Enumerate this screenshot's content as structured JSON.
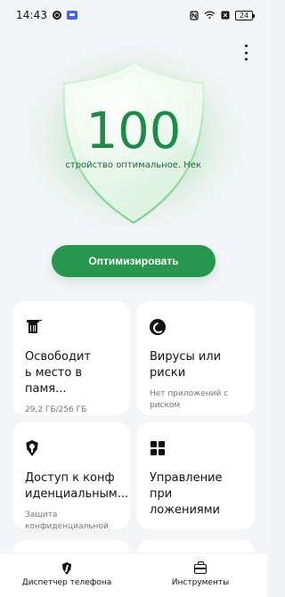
{
  "status_bar": {
    "time": "14:43",
    "battery": "24",
    "icons": [
      "gear-icon",
      "app-icon",
      "nfc-icon",
      "wifi-icon",
      "close-box-icon",
      "battery-icon"
    ]
  },
  "hero": {
    "score": "100",
    "status_text": "Ваше устройство оптимальное. Некоторые"
  },
  "actions": {
    "optimize_label": "Оптимизировать"
  },
  "cards": [
    {
      "title": "Освободит\nь место в памя...",
      "subtitle": "29,2 ГБ/256 ГБ",
      "icon": "trash-icon"
    },
    {
      "title": "Вирусы или\nриски",
      "subtitle": "Нет приложений с\nриском",
      "icon": "virus-scan-icon"
    },
    {
      "title": "Доступ к конф\nиденциальным...",
      "subtitle": "Защита\nконфиденциальной",
      "icon": "privacy-shield-icon"
    },
    {
      "title": "Управление при\nложениями",
      "subtitle": "",
      "icon": "apps-grid-icon"
    }
  ],
  "bottom_nav": {
    "items": [
      {
        "label": "Диспетчер телефона",
        "icon": "phone-manager-icon"
      },
      {
        "label": "Инструменты",
        "icon": "toolbox-icon"
      }
    ]
  },
  "colors": {
    "accent": "#27974d",
    "score": "#1f8a48",
    "background": "#f4f5f7"
  }
}
